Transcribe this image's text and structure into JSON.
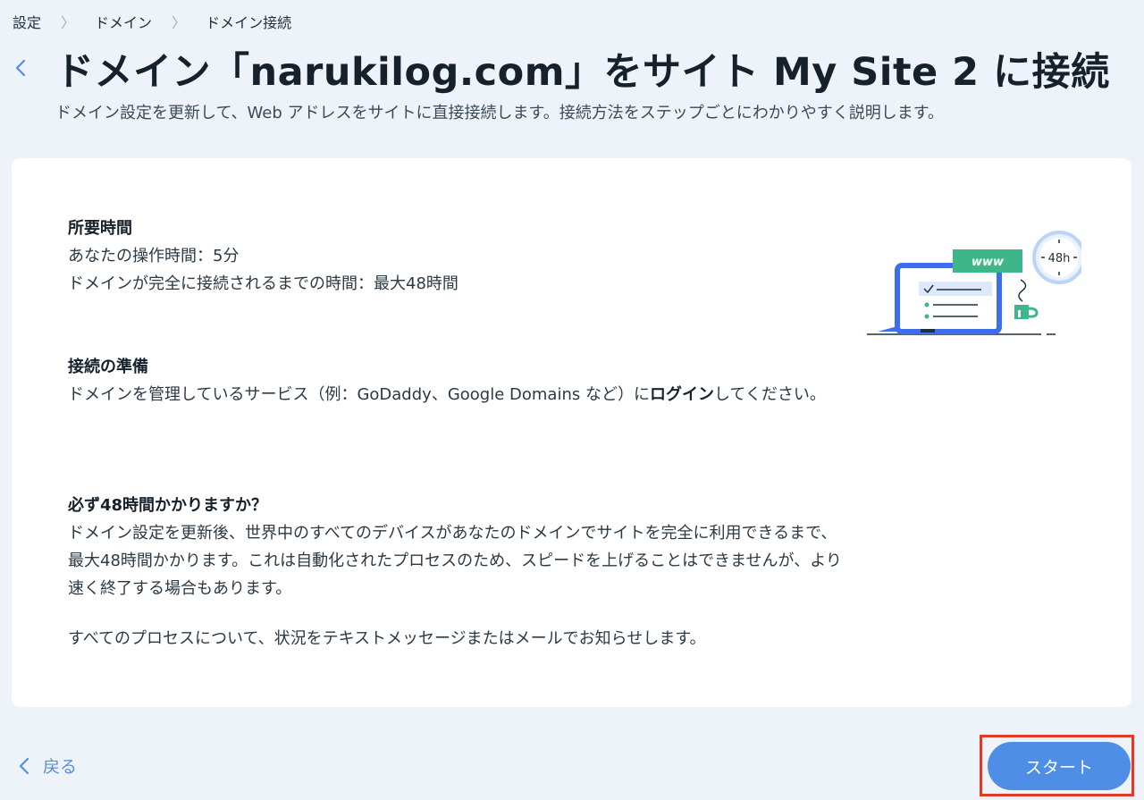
{
  "breadcrumb": {
    "items": [
      "設定",
      "ドメイン",
      "ドメイン接続"
    ],
    "separator": "〉"
  },
  "header": {
    "title": "ドメイン「narukilog.com」をサイト My Site 2 に接続",
    "subtitle": "ドメイン設定を更新して、Web アドレスをサイトに直接接続します。接続方法をステップごとにわかりやすく説明します。"
  },
  "sections": {
    "time": {
      "heading": "所要時間",
      "lines": [
        "あなたの操作時間：5分",
        "ドメインが完全に接続されるまでの時間：最大48時間"
      ]
    },
    "prep": {
      "heading": "接続の準備",
      "text_before": "ドメインを管理しているサービス（例：GoDaddy、Google Domains など）に",
      "text_bold": "ログイン",
      "text_after": "してください。"
    },
    "always48": {
      "heading": "必ず48時間かかりますか？",
      "text": "ドメイン設定を更新後、世界中のすべてのデバイスがあなたのドメインでサイトを完全に利用できるまで、最大48時間かかります。これは自動化されたプロセスのため、スピードを上げることはできませんが、より速く終了する場合もあります。"
    },
    "notify": {
      "text": "すべてのプロセスについて、状況をテキストメッセージまたはメールでお知らせします。"
    }
  },
  "illustration": {
    "www_label": "www",
    "clock_label": "48h"
  },
  "footer": {
    "back_label": "戻る",
    "start_label": "スタート"
  },
  "colors": {
    "accent": "#4f8ee6",
    "highlight": "#e03a24",
    "background": "#eef3f9"
  },
  "icons": {
    "back": "chevron-left-icon",
    "breadcrumb_separator": "chevron-right-icon"
  }
}
